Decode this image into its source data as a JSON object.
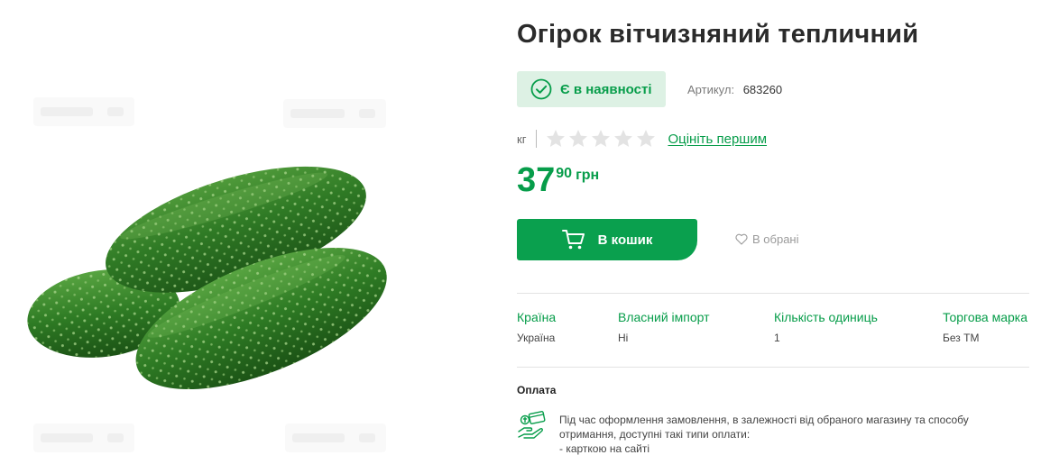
{
  "product": {
    "title": "Огірок вітчизняний тепличний",
    "stock_label": "Є в наявності",
    "sku_label": "Артикул:",
    "sku_value": "683260",
    "unit": "кг",
    "rating_stars": 0,
    "rating_max": 5,
    "rate_first_label": "Оцініть першим",
    "price_integer": "37",
    "price_fraction": "90",
    "currency": "грн"
  },
  "actions": {
    "add_to_cart_label": "В кошик",
    "favorite_label": "В обрані"
  },
  "attributes": [
    {
      "name": "Країна",
      "value": "Україна"
    },
    {
      "name": "Власний імпорт",
      "value": "Ні"
    },
    {
      "name": "Кількість одиниць",
      "value": "1"
    },
    {
      "name": "Торгова марка",
      "value": "Без ТМ"
    }
  ],
  "payment": {
    "title": "Оплата",
    "description_line1": "Під час оформлення замовлення, в залежності від обраного магазину та способу",
    "description_line2": "отримання, доступні такі типи оплати:",
    "description_line3": "- карткою на сайті"
  },
  "colors": {
    "brand_green": "#079d4a",
    "button_green": "#0aa04e",
    "badge_bg": "#ddf1e4",
    "star_empty": "#e3e3e3"
  },
  "icons": [
    "check-circle-icon",
    "star-icon",
    "cart-icon",
    "heart-icon",
    "payment-icon"
  ]
}
